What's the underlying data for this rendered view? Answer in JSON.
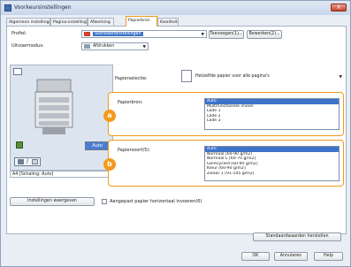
{
  "window": {
    "title": "Voorkeursinstellingen",
    "close_label": "X"
  },
  "tabs": [
    {
      "label": "Algemene instellingen"
    },
    {
      "label": "Pagina-instelling"
    },
    {
      "label": "Afwerking"
    },
    {
      "label": "Papierbron"
    },
    {
      "label": "Kwaliteit"
    }
  ],
  "profile": {
    "label": "Profiel:",
    "value": "Standaardinstellingen",
    "add_button": "Toevoegen(1)...",
    "edit_button": "Bewerken(2)..."
  },
  "output_method": {
    "label": "Uitvoermodus:",
    "value": "Afdrukken"
  },
  "paper_selection": {
    "label": "Papierselectie:",
    "value": "Hetzelfde papier voor alle pagina's"
  },
  "paper_source": {
    "badge": "a",
    "label": "Papierbron:",
    "options": [
      "Auto",
      "Multifunctionele invoer",
      "Lade 1",
      "Lade 2",
      "Lade 3"
    ],
    "selected_index": 0
  },
  "paper_type": {
    "badge": "b",
    "label": "Papiersoort(5):",
    "options": [
      "Auto",
      "Normaal [60-90 g/m2]",
      "Normaal L [60-70 g/m2]",
      "Gerecycled [60-90 g/m2]",
      "Kleur [60-90 g/m2]",
      "Zwaar 1 [91-105 g/m2]"
    ],
    "selected_index": 0
  },
  "preview": {
    "auto_label": "Auto",
    "status": "A4 [Schaling: Auto]"
  },
  "view_settings_button": "Instellingen weergeven",
  "manual_feed_checkbox": {
    "label": "Aangepast papier horizontaal invoeren(6)",
    "checked": false
  },
  "restore_defaults_button": "Standaardwaarden herstellen",
  "footer": {
    "ok": "OK",
    "cancel": "Annuleren",
    "help": "Help"
  },
  "colors": {
    "accent": "#f29a1d",
    "selection": "#3e73c9"
  }
}
